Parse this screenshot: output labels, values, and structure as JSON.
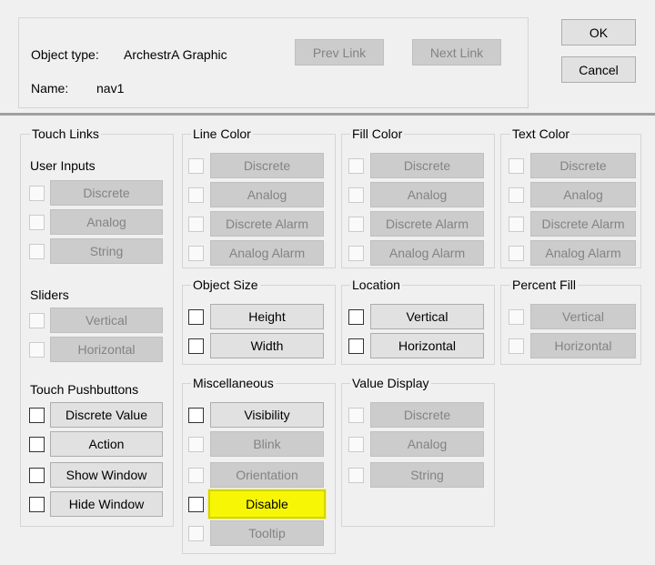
{
  "header": {
    "object_type_label": "Object type:",
    "object_type_value": "ArchestrA Graphic",
    "name_label": "Name:",
    "name_value": "nav1",
    "prev_link": "Prev Link",
    "next_link": "Next Link",
    "ok": "OK",
    "cancel": "Cancel"
  },
  "touch_links": {
    "title": "Touch Links",
    "user_inputs": {
      "title": "User Inputs",
      "items": [
        "Discrete",
        "Analog",
        "String"
      ]
    },
    "sliders": {
      "title": "Sliders",
      "items": [
        "Vertical",
        "Horizontal"
      ]
    },
    "touch_pushbuttons": {
      "title": "Touch Pushbuttons",
      "items": [
        "Discrete Value",
        "Action",
        "Show Window",
        "Hide Window"
      ]
    }
  },
  "line_color": {
    "title": "Line Color",
    "items": [
      "Discrete",
      "Analog",
      "Discrete Alarm",
      "Analog Alarm"
    ]
  },
  "fill_color": {
    "title": "Fill Color",
    "items": [
      "Discrete",
      "Analog",
      "Discrete Alarm",
      "Analog Alarm"
    ]
  },
  "text_color": {
    "title": "Text Color",
    "items": [
      "Discrete",
      "Analog",
      "Discrete Alarm",
      "Analog Alarm"
    ]
  },
  "object_size": {
    "title": "Object Size",
    "items": [
      "Height",
      "Width"
    ]
  },
  "location": {
    "title": "Location",
    "items": [
      "Vertical",
      "Horizontal"
    ]
  },
  "percent_fill": {
    "title": "Percent Fill",
    "items": [
      "Vertical",
      "Horizontal"
    ]
  },
  "miscellaneous": {
    "title": "Miscellaneous",
    "items": [
      "Visibility",
      "Blink",
      "Orientation",
      "Disable",
      "Tooltip"
    ]
  },
  "value_display": {
    "title": "Value Display",
    "items": [
      "Discrete",
      "Analog",
      "String"
    ]
  },
  "colors": {
    "highlight": "#f7f705",
    "disabled_text": "#838383",
    "background": "#f0f0f0"
  }
}
